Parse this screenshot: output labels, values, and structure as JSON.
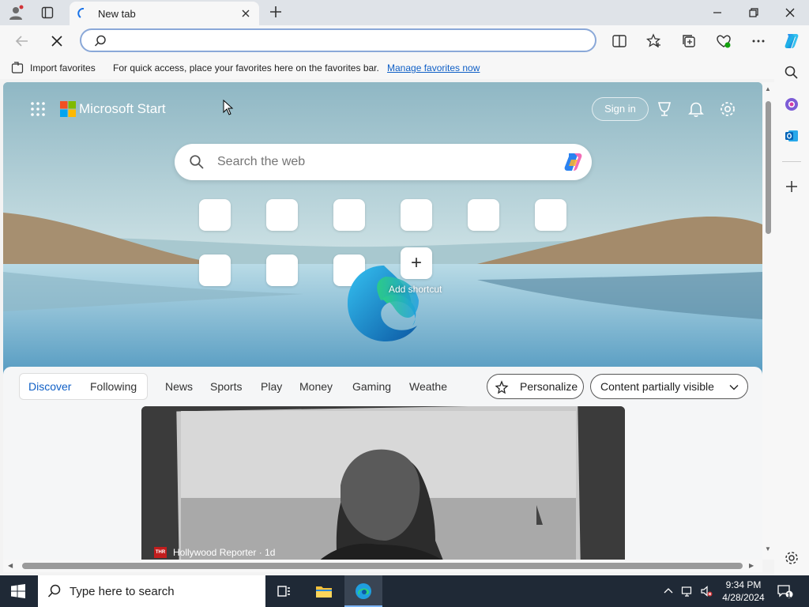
{
  "browser": {
    "tab_title": "New tab",
    "omnibox_value": "",
    "favorites_bar": {
      "import_label": "Import favorites",
      "message": "For quick access, place your favorites here on the favorites bar.",
      "manage_link": "Manage favorites now"
    }
  },
  "newtab": {
    "brand": "Microsoft Start",
    "sign_in": "Sign in",
    "search_placeholder": "Search the web",
    "add_shortcut_label": "Add shortcut",
    "feed_tabs": [
      {
        "label": "Discover",
        "active": true
      },
      {
        "label": "Following",
        "active": false
      },
      {
        "label": "News",
        "active": false
      },
      {
        "label": "Sports",
        "active": false
      },
      {
        "label": "Play",
        "active": false
      },
      {
        "label": "Money",
        "active": false
      },
      {
        "label": "Gaming",
        "active": false
      },
      {
        "label": "Weathe",
        "active": false
      }
    ],
    "personalize": "Personalize",
    "content_visibility": "Content partially visible",
    "card": {
      "source_logo": "THR",
      "source": "Hollywood Reporter · 1d"
    }
  },
  "taskbar": {
    "search_placeholder": "Type here to search",
    "time": "9:34 PM",
    "date": "4/28/2024",
    "notification_count": "1"
  },
  "colors": {
    "accent": "#0f5fc6",
    "taskbar": "#1f2936"
  }
}
